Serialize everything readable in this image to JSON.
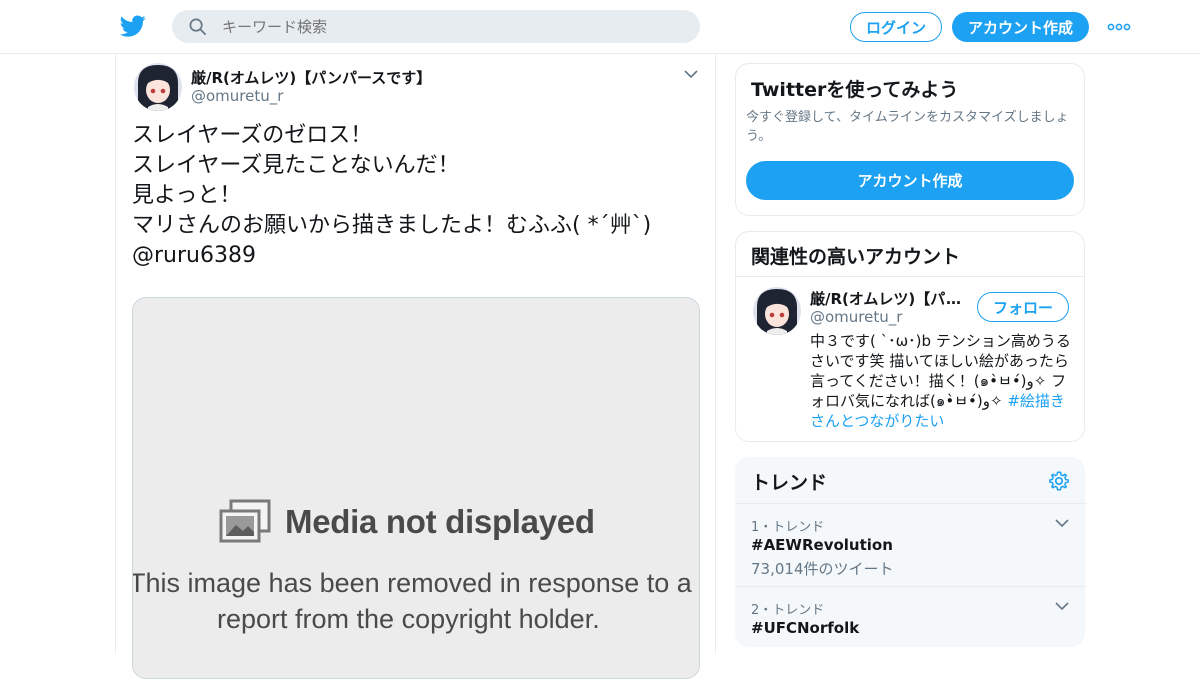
{
  "header": {
    "search_placeholder": "キーワード検索",
    "login_label": "ログイン",
    "signup_label": "アカウント作成",
    "brand_color": "#1da1f2"
  },
  "tweet": {
    "author_name": "厳/R(オムレツ)【パンパースです】",
    "author_handle": "@omuretu_r",
    "lines": [
      "スレイヤーズのゼロス！",
      "スレイヤーズ見たことないんだ！",
      "見よっと！",
      "マリさんのお願いから描きましたよ！むふふ( *´艸`)",
      "@ruru6389"
    ],
    "media": {
      "title": "Media not displayed",
      "line1": "This image has been removed in response to a",
      "line2": "report from the copyright holder."
    }
  },
  "sidebar": {
    "try": {
      "title": "Twitterを使ってみよう",
      "description": "今すぐ登録して、タイムラインをカスタマイズしましょう。",
      "button_label": "アカウント作成"
    },
    "related": {
      "title": "関連性の高いアカウント",
      "account": {
        "name": "厳/R(オムレツ)【パンパースです】",
        "handle": "@omuretu_r",
        "follow_label": "フォロー",
        "bio": "中３です( `･ω･)b テンション高めうるさいです笑 描いてほしい絵があったら言ってください！描く！(๑•̀ㅂ•́)و✧ フォロバ気になれば(๑•̀ㅂ•́)و✧",
        "bio_tag": "#絵描きさんとつながりたい"
      }
    },
    "trends": {
      "title": "トレンド",
      "items": [
        {
          "meta": "1・トレンド",
          "name": "#AEWRevolution",
          "count": "73,014件のツイート"
        },
        {
          "meta": "2・トレンド",
          "name": "#UFCNorfolk",
          "count": ""
        }
      ]
    }
  }
}
